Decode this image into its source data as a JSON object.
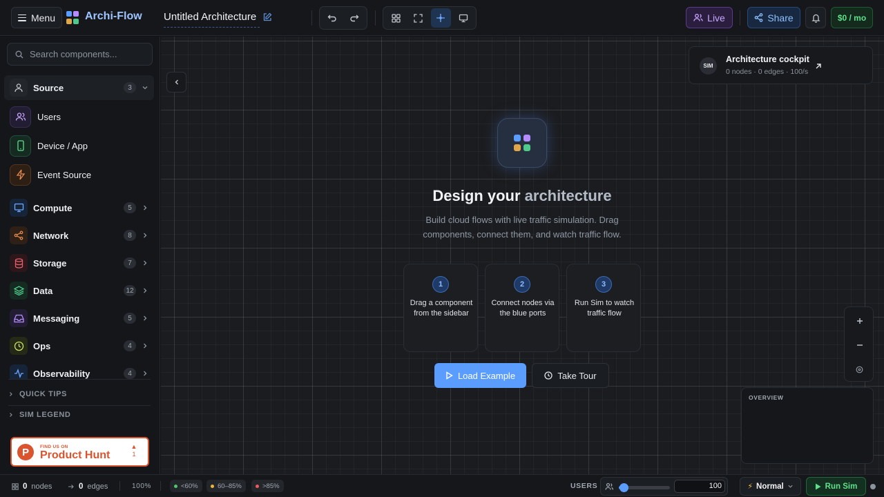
{
  "topbar": {
    "menu_label": "Menu",
    "app_name": "Archi-Flow",
    "doc_title": "Untitled Architecture",
    "live_label": "Live",
    "share_label": "Share",
    "cost_label": "$0 / mo"
  },
  "sidebar": {
    "search_placeholder": "Search components...",
    "categories": [
      {
        "label": "Source",
        "count": "3",
        "expanded": true,
        "color": "#9aa3b0"
      },
      {
        "label": "Compute",
        "count": "5",
        "color": "#5b9dff"
      },
      {
        "label": "Network",
        "count": "8",
        "color": "#e58a4e"
      },
      {
        "label": "Storage",
        "count": "7",
        "color": "#e05f6a"
      },
      {
        "label": "Data",
        "count": "12",
        "color": "#4ec98a"
      },
      {
        "label": "Messaging",
        "count": "5",
        "color": "#b48cff"
      },
      {
        "label": "Ops",
        "count": "4",
        "color": "#c8e36a"
      },
      {
        "label": "Observability",
        "count": "4",
        "color": "#5b9dff"
      }
    ],
    "source_items": [
      {
        "label": "Users",
        "color": "#b48cff"
      },
      {
        "label": "Device / App",
        "color": "#4ec98a"
      },
      {
        "label": "Event Source",
        "color": "#e58a4e"
      }
    ],
    "quick_tips": "QUICK TIPS",
    "sim_legend": "SIM LEGEND",
    "product_hunt": {
      "small": "FIND US ON",
      "big": "Product Hunt",
      "upvotes": "1"
    }
  },
  "canvas": {
    "cockpit": {
      "badge": "SIM",
      "title": "Architecture cockpit",
      "subtitle": "0 nodes · 0 edges · 100/s"
    },
    "hero": {
      "title_main": "Design your ",
      "title_dim": "architecture",
      "description": "Build cloud flows with live traffic simulation. Drag components, connect them, and watch traffic flow."
    },
    "steps": [
      {
        "num": "1",
        "text": "Drag a component from the sidebar"
      },
      {
        "num": "2",
        "text": "Connect nodes via the blue ports"
      },
      {
        "num": "3",
        "text": "Run Sim to watch traffic flow"
      }
    ],
    "load_example_label": "Load Example",
    "take_tour_label": "Take Tour",
    "overview_label": "OVERVIEW"
  },
  "bottombar": {
    "nodes_count": "0",
    "nodes_label": "nodes",
    "edges_count": "0",
    "edges_label": "edges",
    "zoom": "100%",
    "legend": [
      {
        "label": "<60%",
        "color": "#4ec96a"
      },
      {
        "label": "60–85%",
        "color": "#f0b43c"
      },
      {
        "label": ">85%",
        "color": "#f05a5a"
      }
    ],
    "users_label": "USERS",
    "users_value": "100",
    "users_slider_fraction": 0.1,
    "speed_label": "Normal",
    "run_label": "Run Sim"
  },
  "colors": {
    "accent": "#5b9dff",
    "background": "#0f1114"
  }
}
